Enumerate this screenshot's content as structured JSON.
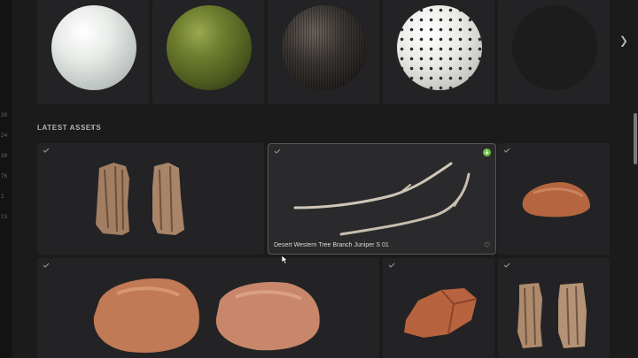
{
  "sidebar": {
    "numbers": [
      "30",
      "24",
      "30",
      "76",
      "1",
      "23"
    ]
  },
  "materials": [
    {
      "name": "white-marble-material",
      "color": "#e6e8e5"
    },
    {
      "name": "mossy-ground-material",
      "color": "#6a7a2e"
    },
    {
      "name": "dark-fabric-material",
      "color": "#2e2b29"
    },
    {
      "name": "floral-tile-material",
      "color": "#ecebe8"
    },
    {
      "name": "square-tile-material",
      "color": "#f0f0ee"
    }
  ],
  "latest": {
    "title": "LATEST ASSETS",
    "highlight_name": "Desert Western Tree Branch Juniper S 01"
  },
  "icons": {
    "check": "check-icon",
    "chevron": "chevron-right-icon",
    "heart": "heart-icon",
    "download": "download-icon"
  },
  "colors": {
    "accent_green": "#6bbf3c",
    "rock": "#b5653f",
    "wood": "#a27e62"
  }
}
